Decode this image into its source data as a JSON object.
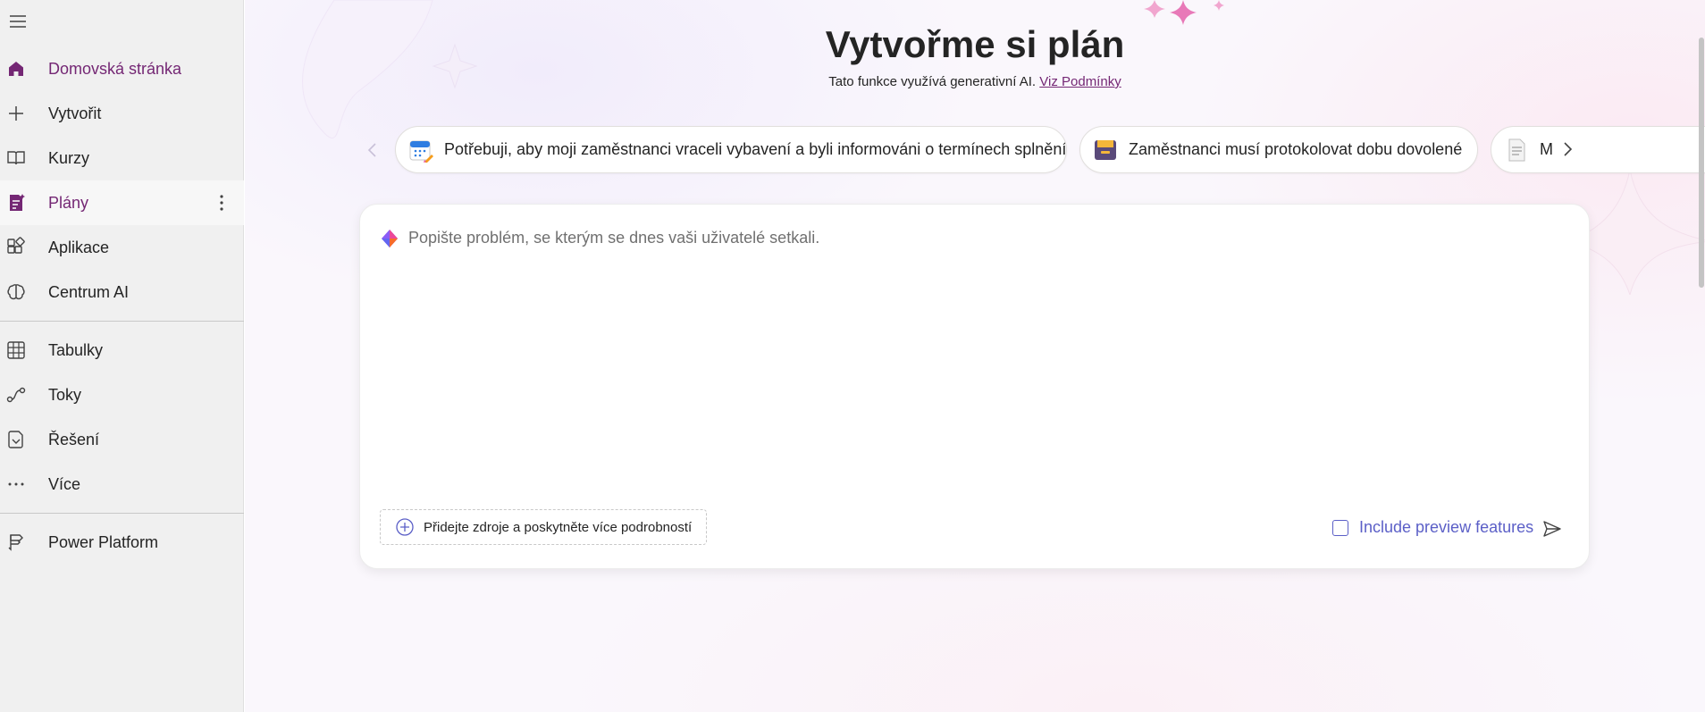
{
  "sidebar": {
    "items": [
      {
        "label": "Domovská stránka",
        "icon": "home-icon"
      },
      {
        "label": "Vytvořit",
        "icon": "plus-icon"
      },
      {
        "label": "Kurzy",
        "icon": "book-icon"
      },
      {
        "label": "Plány",
        "icon": "plan-icon"
      },
      {
        "label": "Aplikace",
        "icon": "apps-icon"
      },
      {
        "label": "Centrum AI",
        "icon": "ai-brain-icon"
      },
      {
        "label": "Tabulky",
        "icon": "table-icon"
      },
      {
        "label": "Toky",
        "icon": "flow-icon"
      },
      {
        "label": "Řešení",
        "icon": "solution-icon"
      },
      {
        "label": "Více",
        "icon": "ellipsis-icon"
      },
      {
        "label": "Power Platform",
        "icon": "power-platform-icon"
      }
    ],
    "active_item": "Plány"
  },
  "main": {
    "title": "Vytvořme si plán",
    "subtitle": "Tato funkce využívá generativní AI.",
    "terms_link": "Viz Podmínky",
    "suggestions": [
      {
        "label": "Potřebuji, aby moji zaměstnanci vraceli vybavení a byli informováni o termínech splnění",
        "icon": "calendar-icon"
      },
      {
        "label": "Zaměstnanci musí protokolovat dobu dovolené",
        "icon": "box-icon"
      },
      {
        "label": "M",
        "icon": "document-icon"
      }
    ],
    "prompt_placeholder": "Popište problém, se kterým se dnes vaši uživatelé setkali.",
    "add_sources_label": "Přidejte zdroje a poskytněte více podrobností",
    "preview_label": "Include preview features",
    "preview_checked": false
  },
  "colors": {
    "accent": "#742774",
    "link_blue": "#5b5fc7",
    "sidebar_bg": "#f0f0f0"
  }
}
